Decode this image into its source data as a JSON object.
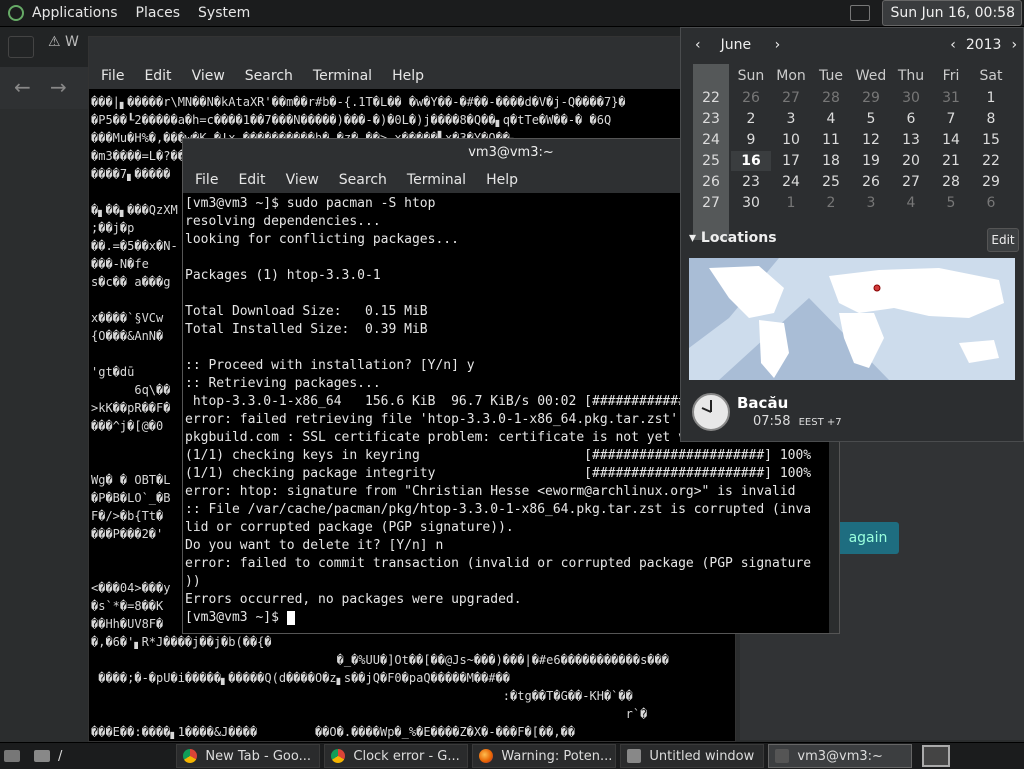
{
  "top_panel": {
    "menus": [
      "Applications",
      "Places",
      "System"
    ],
    "clock": "Sun Jun 16, 00:58"
  },
  "background_browser": {
    "tab_label": "W",
    "again_button": "again"
  },
  "back_terminal": {
    "menus": [
      "File",
      "Edit",
      "View",
      "Search",
      "Terminal",
      "Help"
    ],
    "lines": [
      "���|▖�����r\\MN��N�kAtaXR'��m��r#b�-{.1T�L�� �w�Y��-�#��-����d�V�j-Q����7}�",
      "�P5��┖2�����a�h=c����1��7���N�����)���-�)�0L�)j����8�Q��▖q�tTe�W��-� �6Q",
      "���Mu�H%�,���w�K.�!x.����������h� �z�.��>.x�����▘x�3�Y�Q��▖",
      "�m3����=L�?������ �",
      "����7▖�����",
      "",
      "�▖��▖���QzXM",
      ";��j�p",
      "��.=�5��x�N-",
      "���-N�fe",
      "s�c�� a���g",
      "",
      "x����`§VCw",
      "{O���&AnN�",
      "",
      "'gt�dū",
      "      6q\\��",
      ">kK��pR��F�",
      "���^j�[@�0",
      "",
      "",
      "Wg� � OBT�L",
      "�P�B�LO`_�B",
      "F�/>�b{Tt�",
      "���P���2�'",
      "",
      "",
      "<���04>���y",
      "�s`*�=8��K",
      "��Hh�UV8F�",
      "�,�6�'▖R*J����j��j�b(��{�",
      "                                  �_�%UU�]Ot��[��@Js~���)���|�#e6�����������s���",
      " ����;�-�pU�i�����▖�����Q(d����O�z▖s��jQ�F0�paQ�����M��#��",
      "                                                         :�tg��T�G��-KH�`��",
      "                                                                          r`�",
      "���E��:����▖1����&J����        ��O�.����Wp�_%�E����Z�X�-���F�[��,��"
    ]
  },
  "front_terminal": {
    "title": "vm3@vm3:~",
    "menus": [
      "File",
      "Edit",
      "View",
      "Search",
      "Terminal",
      "Help"
    ],
    "lines": [
      "[vm3@vm3 ~]$ sudo pacman -S htop",
      "resolving dependencies...",
      "looking for conflicting packages...",
      "",
      "Packages (1) htop-3.3.0-1",
      "",
      "Total Download Size:   0.15 MiB",
      "Total Installed Size:  0.39 MiB",
      "",
      ":: Proceed with installation? [Y/n] y",
      ":: Retrieving packages...",
      " htop-3.3.0-1-x86_64   156.6 KiB  96.7 KiB/s 00:02 [######################] 100%",
      "error: failed retrieving file 'htop-3.3.0-1-x86_64.pkg.tar.zst' from mirror.",
      "pkgbuild.com : SSL certificate problem: certificate is not yet valid",
      "(1/1) checking keys in keyring                     [######################] 100%",
      "(1/1) checking package integrity                   [######################] 100%",
      "error: htop: signature from \"Christian Hesse <eworm@archlinux.org>\" is invalid",
      ":: File /var/cache/pacman/pkg/htop-3.3.0-1-x86_64.pkg.tar.zst is corrupted (inva",
      "lid or corrupted package (PGP signature)).",
      "Do you want to delete it? [Y/n] n",
      "error: failed to commit transaction (invalid or corrupted package (PGP signature",
      "))",
      "Errors occurred, no packages were upgraded.",
      "[vm3@vm3 ~]$ "
    ]
  },
  "calendar": {
    "month": "June",
    "year": "2013",
    "day_names": [
      "Sun",
      "Mon",
      "Tue",
      "Wed",
      "Thu",
      "Fri",
      "Sat"
    ],
    "week_numbers": [
      "22",
      "23",
      "24",
      "25",
      "26",
      "27"
    ],
    "weeks": [
      [
        "26",
        "27",
        "28",
        "29",
        "30",
        "31",
        "1"
      ],
      [
        "2",
        "3",
        "4",
        "5",
        "6",
        "7",
        "8"
      ],
      [
        "9",
        "10",
        "11",
        "12",
        "13",
        "14",
        "15"
      ],
      [
        "16",
        "17",
        "18",
        "19",
        "20",
        "21",
        "22"
      ],
      [
        "23",
        "24",
        "25",
        "26",
        "27",
        "28",
        "29"
      ],
      [
        "30",
        "1",
        "2",
        "3",
        "4",
        "5",
        "6"
      ]
    ],
    "today": "16",
    "locations_label": "Locations",
    "edit_label": "Edit",
    "city": "Bacău",
    "city_time": "07:58",
    "city_tz": "EEST +7"
  },
  "taskbar": {
    "path_label": "/",
    "tasks": [
      {
        "label": "New Tab - Goo...",
        "icon": "chrome-icon"
      },
      {
        "label": "Clock error - G...",
        "icon": "chrome-icon"
      },
      {
        "label": "Warning: Poten...",
        "icon": "firefox-icon"
      },
      {
        "label": "Untitled window",
        "icon": "window-icon"
      },
      {
        "label": "vm3@vm3:~",
        "icon": "terminal-icon"
      }
    ]
  },
  "colors": {
    "panel": "#1b1c1d",
    "terminal_bg": "#000000",
    "map_water": "#c8d8ea",
    "map_land": "#ffffff"
  }
}
